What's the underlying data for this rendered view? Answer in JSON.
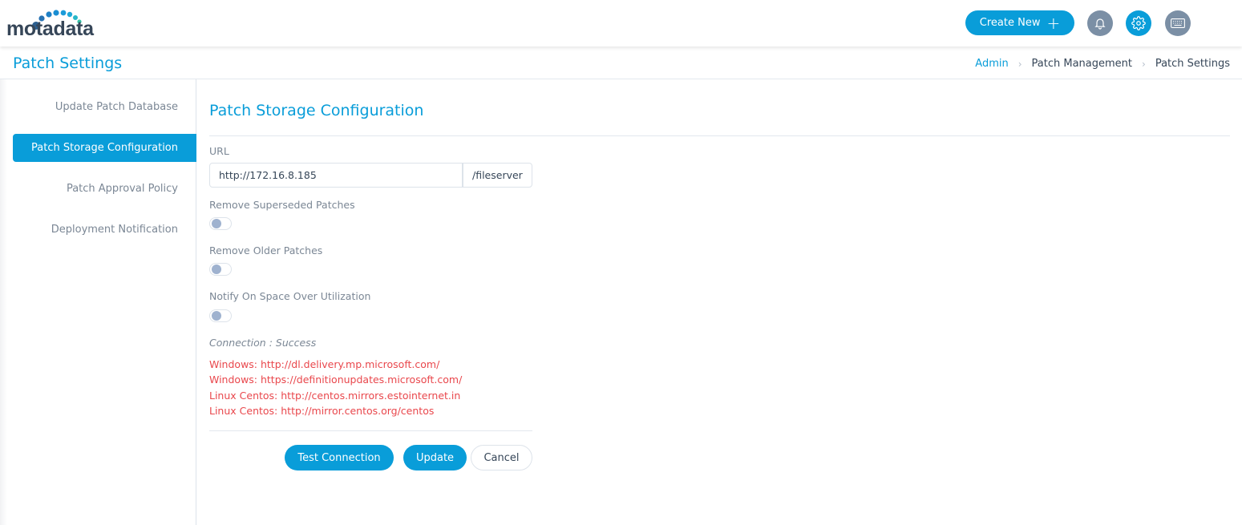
{
  "app": {
    "brand": "motadata",
    "colors": {
      "accent": "#099dd9",
      "danger": "#e9474c",
      "muted": "#7b8795",
      "icon_gray": "#7b8fa5"
    }
  },
  "header": {
    "create_new_label": "Create New",
    "icons": {
      "create": "plus-icon",
      "notifications": "bell-icon",
      "settings": "gear-icon",
      "keyboard": "keyboard-icon"
    }
  },
  "titlebar": {
    "page_title": "Patch Settings",
    "breadcrumb": [
      {
        "label": "Admin"
      },
      {
        "label": "Patch Management"
      },
      {
        "label": "Patch Settings"
      }
    ]
  },
  "sidebar": {
    "items": [
      {
        "label": "Update Patch Database",
        "active": false
      },
      {
        "label": "Patch Storage Configuration",
        "active": true
      },
      {
        "label": "Patch Approval Policy",
        "active": false
      },
      {
        "label": "Deployment Notification",
        "active": false
      }
    ]
  },
  "form": {
    "title": "Patch Storage Configuration",
    "url_label": "URL",
    "url_value": "http://172.16.8.185",
    "url_suffix": "/fileserver",
    "toggles": [
      {
        "label": "Remove Superseded Patches",
        "on": false
      },
      {
        "label": "Remove Older Patches",
        "on": false
      },
      {
        "label": "Notify On Space Over Utilization",
        "on": false
      }
    ],
    "connection_status": "Connection : Success",
    "repositories": [
      "Windows: http://dl.delivery.mp.microsoft.com/",
      "Windows: https://definitionupdates.microsoft.com/",
      "Linux Centos: http://centos.mirrors.estointernet.in",
      "Linux Centos: http://mirror.centos.org/centos"
    ],
    "buttons": {
      "test_connection": "Test Connection",
      "update": "Update",
      "cancel": "Cancel"
    }
  }
}
